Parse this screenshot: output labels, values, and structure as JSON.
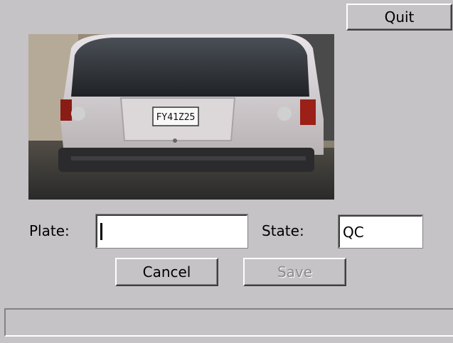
{
  "toolbar": {
    "quit_label": "Quit"
  },
  "photo": {
    "plate_text": "FY41Z25"
  },
  "form": {
    "plate_label": "Plate:",
    "plate_value": "",
    "state_label": "State:",
    "state_value": "QC"
  },
  "actions": {
    "cancel_label": "Cancel",
    "save_label": "Save",
    "save_enabled": false
  },
  "status": {
    "text": ""
  }
}
